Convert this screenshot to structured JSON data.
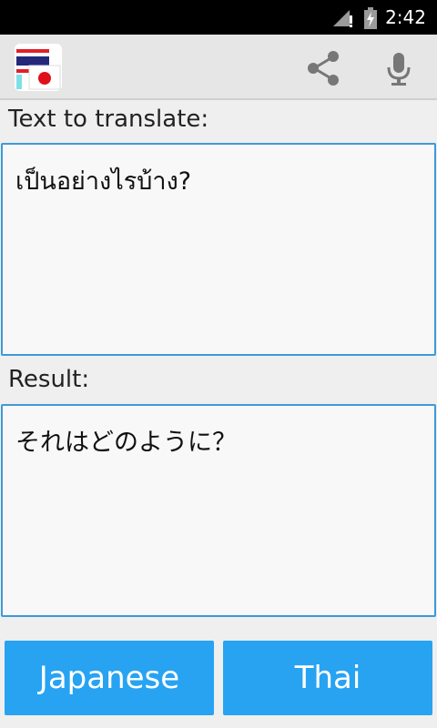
{
  "status_bar": {
    "time": "2:42",
    "icons": [
      "signal-icon",
      "battery-icon"
    ]
  },
  "action_bar": {
    "app_icon": "thai-japanese-flags-icon",
    "actions": [
      "share-icon",
      "microphone-icon"
    ]
  },
  "source": {
    "label": "Text to translate:",
    "text": "เป็นอย่างไรบ้าง?"
  },
  "result": {
    "label": "Result:",
    "text": "それはどのように？"
  },
  "buttons": {
    "from_language": "Japanese",
    "to_language": "Thai"
  },
  "colors": {
    "accent": "#27a3f2",
    "border": "#3d9ad8",
    "background": "#efefef",
    "action_bar": "#e6e6e6"
  }
}
